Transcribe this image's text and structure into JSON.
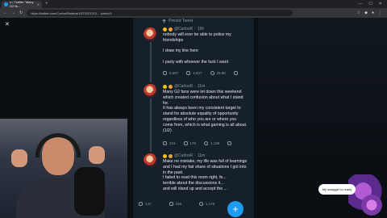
{
  "browser": {
    "tab_title": "x • Twitter \"Many G2 fa...",
    "url": "https://twitter.com/CarlosR/status/1572321212... /photo/1"
  },
  "pinned_label": "Pinned Tweet",
  "tweets": [
    {
      "handle": "@CarlosR",
      "time": "16h",
      "text": "nobody will ever be able to police my friendships\n\nI draw my line here\n\nI party with whoever the fuck I want",
      "stats": {
        "replies": "5,697",
        "retweets": "4,627",
        "likes": "29.9K"
      }
    },
    {
      "handle": "@CarlosR",
      "time": "11m",
      "text": "Many G2 fans were let down this weekend which created confusion about what I stand for.\nIt has always been my consistent target to stand for absolute equality of opportunity regardless of who you are or where you come from, which is what gaming is all about. (1/2)",
      "stats": {
        "replies": "315",
        "retweets": "176",
        "likes": "1,199"
      }
    },
    {
      "handle": "@CarlosR",
      "time": "11m",
      "text": "Make no mistake, my life was full of learnings and I had my fair share of situations I got into in the past.\nI failed to read this room right, fe...\nterrible about the discussions it...\nand will stand up and accept the ..."
    }
  ],
  "bottom_stats": {
    "replies": "147",
    "retweets": "238",
    "likes": "1,176"
  },
  "overlay_speech": "My swagger is ready",
  "icons": {
    "close": "close-icon",
    "compose": "compose-plus-icon"
  },
  "colors": {
    "accent": "#1d9bf0",
    "bg": "#15202b"
  }
}
